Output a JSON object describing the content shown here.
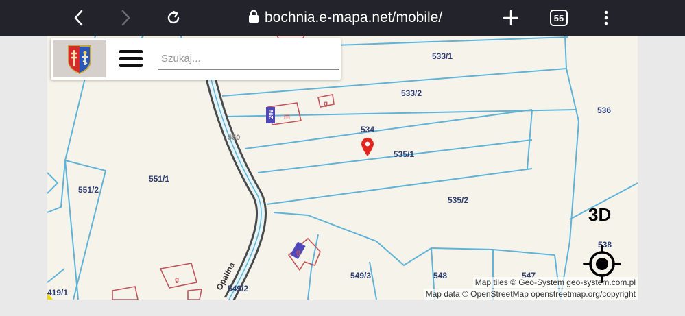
{
  "browser": {
    "url": "bochnia.e-mapa.net/mobile/",
    "tab_count": "55"
  },
  "search": {
    "placeholder": "Szukaj..."
  },
  "map": {
    "plot_labels": [
      "533/1",
      "533/2",
      "536",
      "534",
      "535/1",
      "551/1",
      "551/2",
      "535/2",
      "3D",
      "538",
      "549/3",
      "548",
      "547",
      "549/2",
      "419/1",
      "209",
      "m",
      "g",
      "g",
      "g",
      "550",
      "Opalina"
    ],
    "button_3d": "3D",
    "attribution_tiles": "Map tiles © Geo-System geo-system.com.pl",
    "attribution_data": "Map data © OpenStreetMap openstreetmap.org/copyright",
    "colors": {
      "parcel_lines": "#5fb3d6",
      "building": "#c0545a",
      "road": "#4a4a4a",
      "marker": "#e2261f",
      "background": "#f6f3ea"
    }
  }
}
